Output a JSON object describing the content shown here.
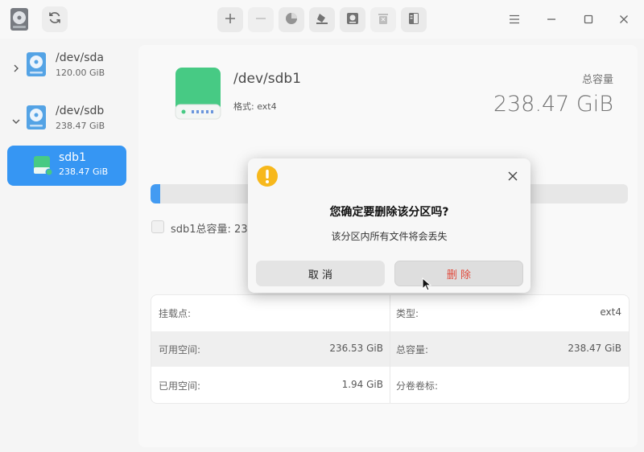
{
  "toolbar": {
    "items": [
      "refresh-icon",
      "plus-icon",
      "minus-icon",
      "pie-chart-icon",
      "format-icon",
      "disk-mount-icon",
      "delete-partition-icon",
      "details-icon"
    ]
  },
  "window_controls": [
    "menu-icon",
    "minimize-icon",
    "maximize-icon",
    "close-icon"
  ],
  "sidebar": {
    "devices": [
      {
        "name": "/dev/sda",
        "size": "120.00 GiB",
        "expanded": false
      },
      {
        "name": "/dev/sdb",
        "size": "238.47 GiB",
        "expanded": true
      }
    ],
    "partitions": [
      {
        "name": "sdb1",
        "size": "238.47 GiB",
        "selected": true
      }
    ]
  },
  "main": {
    "partition_name": "/dev/sdb1",
    "format_label": "格式: ext4",
    "total_label": "总容量",
    "total_value": "238.47 GiB",
    "usage_fraction": 0.02,
    "legend_text": "sdb1总容量:  23",
    "info": {
      "mount_label": "挂载点:",
      "mount_value": "",
      "type_label": "类型:",
      "type_value": "ext4",
      "free_label": "可用空间:",
      "free_value": "236.53 GiB",
      "capacity_label": "总容量:",
      "capacity_value": "238.47 GiB",
      "used_label": "已用空间:",
      "used_value": "1.94 GiB",
      "volume_label": "分卷卷标:",
      "volume_value": ""
    }
  },
  "dialog": {
    "title": "您确定要删除该分区吗?",
    "message": "该分区内所有文件将会丢失",
    "cancel_label": "取 消",
    "delete_label": "删 除"
  },
  "colors": {
    "accent": "#0a7ff1",
    "drive_green": "#1fbf6a",
    "warning": "#f7b81c",
    "danger_text": "#e04a3c"
  }
}
